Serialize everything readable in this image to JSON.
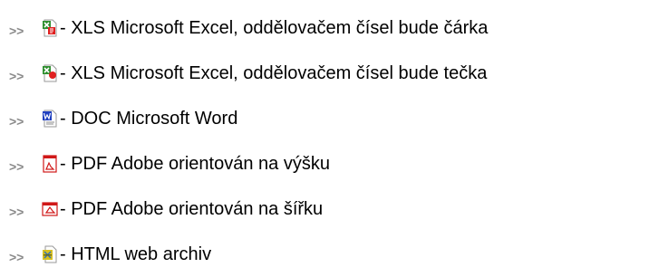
{
  "export_options": [
    {
      "arrow": ">>",
      "icon": "excel-comma-icon",
      "text": " - XLS Microsoft Excel, oddělovačem čísel bude čárka"
    },
    {
      "arrow": ">>",
      "icon": "excel-dot-icon",
      "text": " - XLS Microsoft Excel, oddělovačem čísel bude tečka"
    },
    {
      "arrow": ">>",
      "icon": "word-doc-icon",
      "text": " - DOC Microsoft Word"
    },
    {
      "arrow": ">>",
      "icon": "pdf-portrait-icon",
      "text": " - PDF Adobe orientován na výšku"
    },
    {
      "arrow": ">>",
      "icon": "pdf-landscape-icon",
      "text": " - PDF Adobe orientován na šířku"
    },
    {
      "arrow": ">>",
      "icon": "html-archive-icon",
      "text": " - HTML web archiv"
    }
  ],
  "colors": {
    "arrow": "#8a8a8a",
    "excel_green": "#2f8f2f",
    "excel_red": "#e02020",
    "word_blue": "#1f3fbf",
    "pdf_red": "#d01818",
    "html_yellow": "#d8c020"
  }
}
